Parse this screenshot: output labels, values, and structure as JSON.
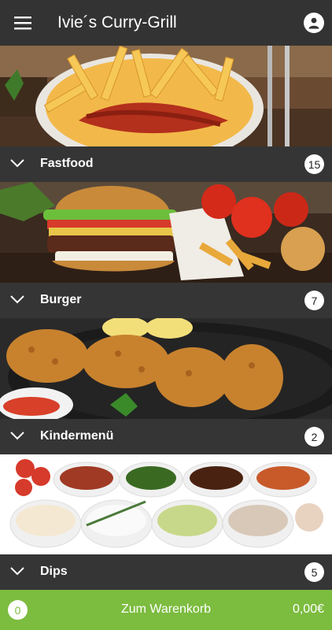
{
  "app": {
    "title": "Ivie´s Curry-Grill"
  },
  "categories": [
    {
      "label": "Fastfood",
      "count": "15"
    },
    {
      "label": "Burger",
      "count": "7"
    },
    {
      "label": "Kindermenü",
      "count": "2"
    },
    {
      "label": "Dips",
      "count": "5"
    }
  ],
  "cart": {
    "count": "0",
    "label": "Zum Warenkorb",
    "total": "0,00€"
  },
  "colors": {
    "appbar": "#333333",
    "category_bar": "#353535",
    "cart": "#7cbc3f"
  }
}
